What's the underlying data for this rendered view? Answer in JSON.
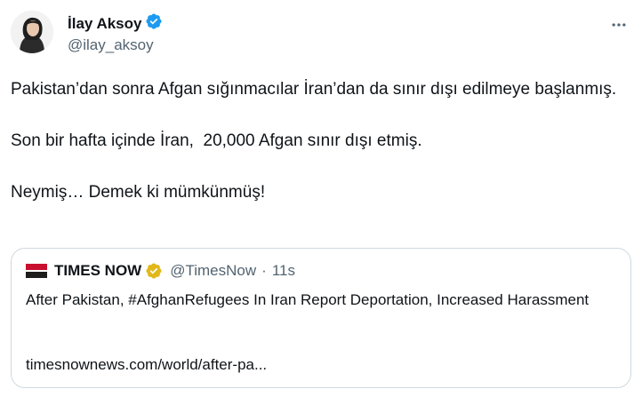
{
  "author": {
    "display_name": "İlay Aksoy",
    "handle": "@ilay_aksoy"
  },
  "tweet": {
    "text": "Pakistan’dan sonra Afgan sığınmacılar İran’dan da sınır dışı edilmeye başlanmış.\n\nSon bir hafta içinde İran,  20,000 Afgan sınır dışı etmiş.\n\nNeymiş… Demek ki mümkünmüş!"
  },
  "quoted": {
    "name": "TIMES NOW",
    "handle": "@TimesNow",
    "separator": "·",
    "time": "11s",
    "text": "After Pakistan, #AfghanRefugees In Iran Report Deportation, Increased Harassment",
    "link": "timesnownews.com/world/after-pa..."
  },
  "colors": {
    "verified_blue": "#1d9bf0",
    "verified_gold": "#e2b719",
    "secondary_text": "#536471",
    "border": "#cfd9de"
  },
  "icons": {
    "more": "more-icon",
    "verified": "verified-badge-icon",
    "verified_org": "verified-org-badge-icon"
  }
}
